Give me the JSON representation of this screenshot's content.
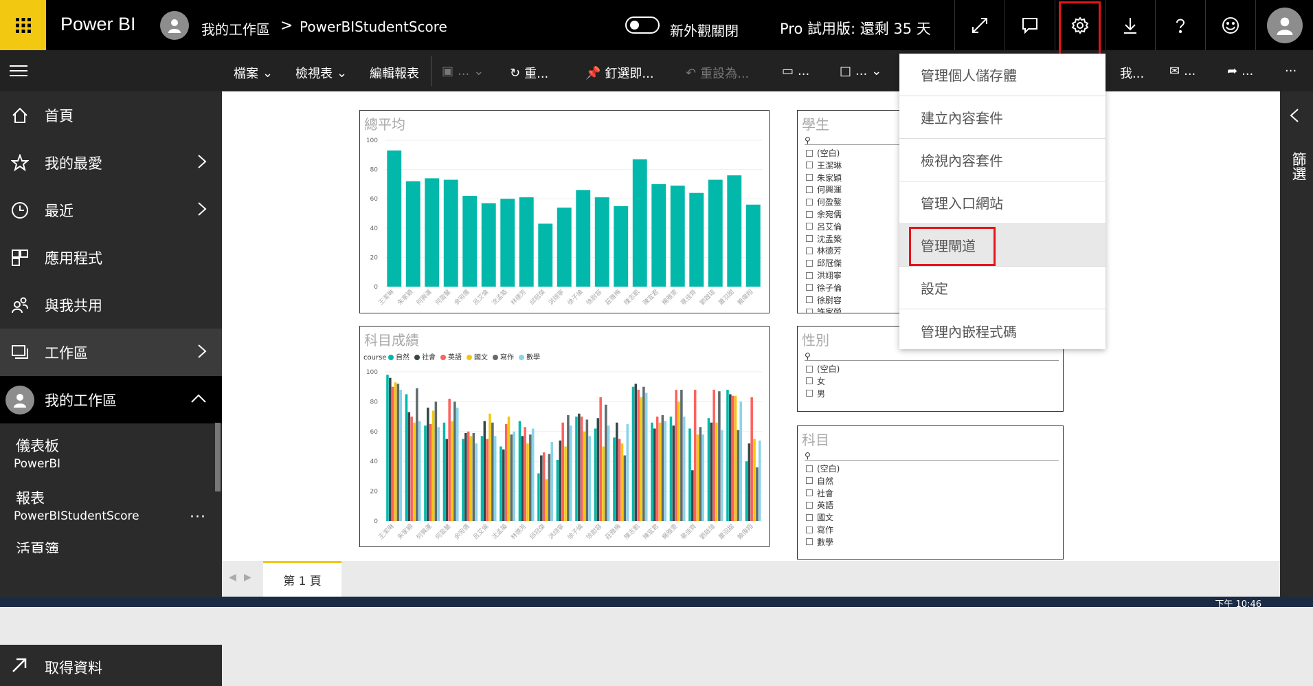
{
  "header": {
    "brand": "Power BI",
    "breadcrumb_workspace": "我的工作區",
    "breadcrumb_sep": ">",
    "breadcrumb_report": "PowerBIStudentScore",
    "new_look_label": "新外觀關閉",
    "trial_label": "Pro 試用版: 還剩 35 天"
  },
  "toolbar": {
    "file": "檔案",
    "view": "檢視表",
    "edit": "編輯報表",
    "more1": "...",
    "refresh": "重...",
    "pin": "釘選即...",
    "reset": "重設為...",
    "comment": "...",
    "bookmark": "...",
    "me": "我...",
    "mail": "...",
    "share": "...",
    "more": "···"
  },
  "sidebar": {
    "items": [
      {
        "label": "首頁"
      },
      {
        "label": "我的最愛"
      },
      {
        "label": "最近"
      },
      {
        "label": "應用程式"
      },
      {
        "label": "與我共用"
      },
      {
        "label": "工作區"
      },
      {
        "label": "我的工作區"
      }
    ],
    "dashboard_head": "儀表板",
    "dashboard_item": "PowerBI",
    "report_head": "報表",
    "report_item": "PowerBIStudentScore",
    "report_more": "···",
    "workbook_head": "活頁簿",
    "get_data": "取得資料"
  },
  "settings_menu": {
    "items": [
      "管理個人儲存體",
      "建立內容套件",
      "檢視內容套件",
      "管理入口網站",
      "管理閘道",
      "設定",
      "管理內嵌程式碼"
    ]
  },
  "right_pane": {
    "filters": "篩選"
  },
  "pages": {
    "tab1": "第 1 頁"
  },
  "clock": "下午 10:46",
  "slicers": {
    "student": {
      "title": "學生",
      "items": [
        "(空白)",
        "王潔琳",
        "朱家穎",
        "何興運",
        "何盈鏊",
        "余宛儒",
        "呂艾倫",
        "沈孟築",
        "林德芳",
        "邱冠傑",
        "洪翊寧",
        "徐子倫",
        "徐尉容",
        "許家榮"
      ]
    },
    "gender": {
      "title": "性別",
      "items": [
        "(空白)",
        "女",
        "男"
      ]
    },
    "subject": {
      "title": "科目",
      "items": [
        "(空白)",
        "自然",
        "社會",
        "英語",
        "國文",
        "寫作",
        "數學"
      ]
    }
  },
  "chart_data": [
    {
      "type": "bar",
      "title": "總平均",
      "categories": [
        "王潔琳",
        "朱家穎",
        "何興運",
        "何盈鏊",
        "余宛儒",
        "呂艾倫",
        "沈孟築",
        "林德芳",
        "邱冠傑",
        "洪翊寧",
        "徐子倫",
        "徐尉容",
        "莊雅梅",
        "陳志凱",
        "陳宜君",
        "楊雅雯",
        "蔡佳齊",
        "劉啟瑄",
        "蕭羽甜",
        "賴偉翔"
      ],
      "values": [
        93,
        72,
        74,
        73,
        62,
        57,
        60,
        61,
        43,
        54,
        66,
        61,
        55,
        87,
        70,
        69,
        64,
        73,
        76,
        56
      ],
      "ylim": [
        0,
        100
      ],
      "yticks": [
        0,
        20,
        40,
        60,
        80,
        100
      ],
      "color": "#01b8aa"
    },
    {
      "type": "bar",
      "title": "科目成績",
      "legend_title": "course",
      "categories": [
        "王潔琳",
        "朱家穎",
        "何興運",
        "何盈鏊",
        "余宛儒",
        "呂艾倫",
        "沈孟築",
        "林德芳",
        "邱冠傑",
        "洪翊寧",
        "徐子倫",
        "徐尉容",
        "莊雅梅",
        "陳志凱",
        "陳宜君",
        "楊雅雯",
        "蔡佳齊",
        "劉啟瑄",
        "蕭羽甜",
        "賴偉翔"
      ],
      "ylim": [
        0,
        100
      ],
      "yticks": [
        0,
        20,
        40,
        60,
        80,
        100
      ],
      "series": [
        {
          "name": "自然",
          "color": "#01b8aa",
          "values": [
            98,
            85,
            64,
            66,
            55,
            57,
            50,
            67,
            32,
            41,
            70,
            62,
            56,
            90,
            66,
            70,
            62,
            69,
            88,
            40
          ]
        },
        {
          "name": "社會",
          "color": "#374649",
          "values": [
            96,
            73,
            76,
            55,
            59,
            67,
            48,
            57,
            44,
            54,
            72,
            69,
            66,
            92,
            62,
            64,
            34,
            66,
            85,
            52
          ]
        },
        {
          "name": "英語",
          "color": "#fd625e",
          "values": [
            90,
            70,
            65,
            82,
            60,
            55,
            65,
            63,
            46,
            66,
            70,
            83,
            55,
            88,
            70,
            88,
            88,
            88,
            84,
            83
          ]
        },
        {
          "name": "國文",
          "color": "#f2c80f",
          "values": [
            93,
            66,
            74,
            67,
            57,
            72,
            70,
            52,
            28,
            50,
            60,
            50,
            52,
            83,
            66,
            80,
            58,
            66,
            84,
            55
          ]
        },
        {
          "name": "寫作",
          "color": "#5f6b6d",
          "values": [
            92,
            89,
            80,
            80,
            59,
            66,
            58,
            58,
            45,
            71,
            68,
            78,
            44,
            90,
            71,
            88,
            63,
            87,
            61,
            36
          ]
        },
        {
          "name": "數學",
          "color": "#8ad4eb",
          "values": [
            88,
            67,
            63,
            76,
            52,
            57,
            60,
            62,
            53,
            64,
            57,
            64,
            65,
            86,
            67,
            70,
            58,
            61,
            80,
            54
          ]
        }
      ]
    }
  ]
}
